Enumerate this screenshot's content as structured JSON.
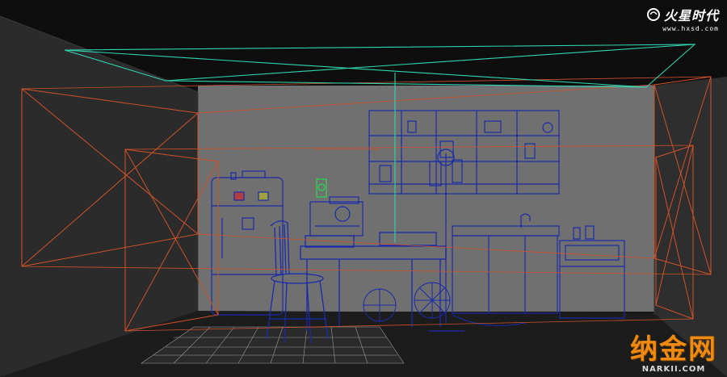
{
  "watermark_top": {
    "brand": "火星时代",
    "url": "www.hxsd.com",
    "icon": "swirl-logo-icon"
  },
  "watermark_bottom": {
    "brand": "纳金网",
    "url": "NARKII.COM"
  },
  "colors": {
    "background": "#181818",
    "back_wall": "#707070",
    "floor": "#1c1c1c",
    "wireframe": "#1a2aa8",
    "light_gizmo": "#d0522a",
    "camera_gizmo": "#2fd7b0",
    "selected_object": "#33cc55",
    "brand_orange": "#f08a10"
  }
}
